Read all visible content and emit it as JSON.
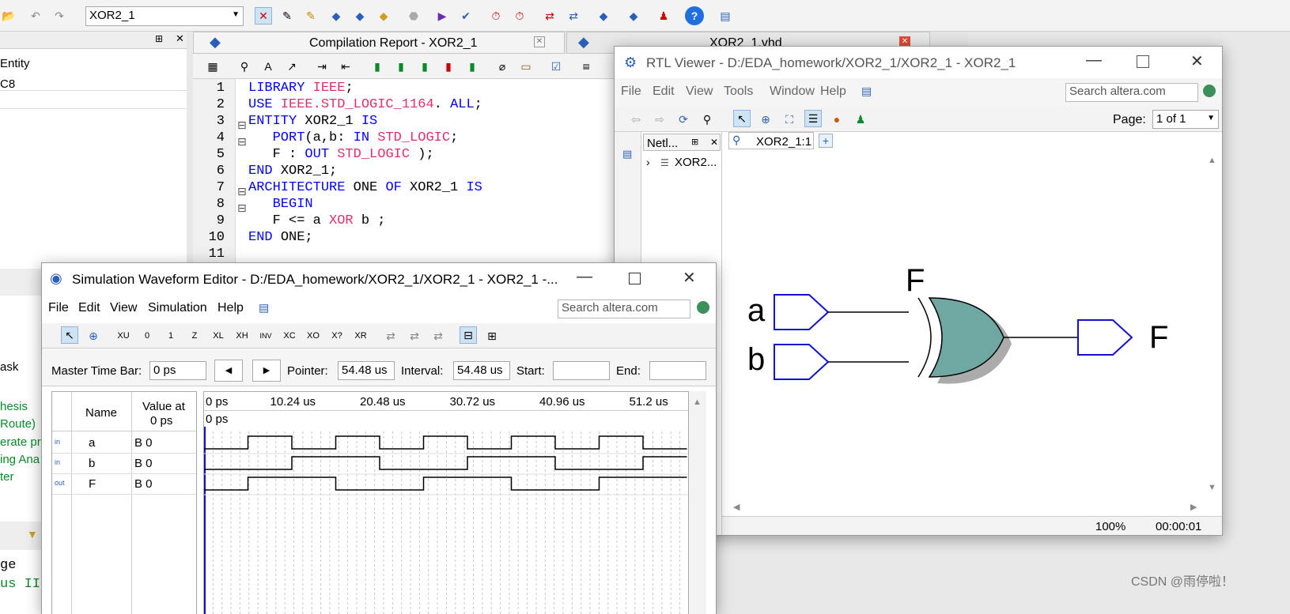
{
  "main": {
    "toolbar": {
      "entity_combo": "XOR2_1"
    },
    "left_panel": {
      "rows": [
        "Entity",
        "C8"
      ],
      "lower_rows": [
        "ask",
        "hesis",
        "Route)",
        "erate pr",
        "ing Ana",
        "ter",
        "ge",
        "us II"
      ]
    },
    "tabs": [
      {
        "label": "Compilation Report - XOR2_1"
      },
      {
        "label": "XOR2_1.vhd"
      }
    ],
    "code": [
      {
        "n": "1",
        "parts": [
          [
            "kw",
            "LIBRARY "
          ],
          [
            "ty",
            "IEEE"
          ],
          [
            "",
            "; "
          ]
        ]
      },
      {
        "n": "2",
        "parts": [
          [
            "kw",
            "USE "
          ],
          [
            "ty",
            "IEEE.STD_LOGIC_1164"
          ],
          [
            "",
            ". "
          ],
          [
            "kw",
            "ALL"
          ],
          [
            "",
            ";"
          ]
        ]
      },
      {
        "n": "3",
        "parts": [
          [
            "kw",
            "ENTITY "
          ],
          [
            "",
            "XOR2_1 "
          ],
          [
            "kw",
            "IS"
          ]
        ]
      },
      {
        "n": "4",
        "parts": [
          [
            "",
            "   "
          ],
          [
            "kw",
            "PORT"
          ],
          [
            "",
            "(a,b: "
          ],
          [
            "kw",
            "IN "
          ],
          [
            "ty",
            "STD_LOGIC"
          ],
          [
            "",
            ";"
          ]
        ]
      },
      {
        "n": "5",
        "parts": [
          [
            "",
            "   F : "
          ],
          [
            "kw",
            "OUT "
          ],
          [
            "ty",
            "STD_LOGIC"
          ],
          [
            "",
            " );"
          ]
        ]
      },
      {
        "n": "6",
        "parts": [
          [
            "kw",
            "END "
          ],
          [
            "",
            "XOR2_1;"
          ]
        ]
      },
      {
        "n": "7",
        "parts": [
          [
            "kw",
            "ARCHITECTURE "
          ],
          [
            "",
            "ONE "
          ],
          [
            "kw",
            "OF "
          ],
          [
            "",
            "XOR2_1 "
          ],
          [
            "kw",
            "IS"
          ]
        ]
      },
      {
        "n": "8",
        "parts": [
          [
            "",
            "   "
          ],
          [
            "kw",
            "BEGIN"
          ]
        ]
      },
      {
        "n": "9",
        "parts": [
          [
            "",
            "   F <= a "
          ],
          [
            "ty",
            "XOR "
          ],
          [
            "",
            "b ;"
          ]
        ]
      },
      {
        "n": "10",
        "parts": [
          [
            "kw",
            "END "
          ],
          [
            "",
            "ONE;"
          ]
        ]
      },
      {
        "n": "11",
        "parts": []
      }
    ]
  },
  "rtl": {
    "title": "RTL Viewer - D:/EDA_homework/XOR2_1/XOR2_1 - XOR2_1",
    "menu": [
      "File",
      "Edit",
      "View",
      "Tools",
      "Window",
      "Help"
    ],
    "search_placeholder": "Search altera.com",
    "page_label": "Page:",
    "page_value": "1 of 1",
    "netlist_tab": "Netl...",
    "tree_item": "XOR2...",
    "view_tab": "XOR2_1:1",
    "inputs": [
      "a",
      "b"
    ],
    "gate_label": "F",
    "output": "F",
    "zoom": "100%",
    "time": "00:00:01"
  },
  "sim": {
    "title": "Simulation Waveform Editor - D:/EDA_homework/XOR2_1/XOR2_1 - XOR2_1 -...",
    "menu": [
      "File",
      "Edit",
      "View",
      "Simulation",
      "Help"
    ],
    "search_placeholder": "Search altera.com",
    "master_time_label": "Master Time Bar:",
    "master_time_value": "0 ps",
    "pointer_label": "Pointer:",
    "pointer_value": "54.48 us",
    "interval_label": "Interval:",
    "interval_value": "54.48 us",
    "start_label": "Start:",
    "end_label": "End:",
    "col_name": "Name",
    "col_value_1": "Value at",
    "col_value_2": "0 ps",
    "time_ticks": [
      "0 ps",
      "10.24 us",
      "20.48 us",
      "30.72 us",
      "40.96 us",
      "51.2 us"
    ],
    "cursor_label": "0 ps",
    "signals": [
      {
        "type": "in",
        "name": "a",
        "value": "B 0",
        "levels": [
          0,
          1,
          0,
          1,
          0,
          1,
          0,
          1,
          0,
          1,
          0
        ]
      },
      {
        "type": "in",
        "name": "b",
        "value": "B 0",
        "levels": [
          0,
          0,
          1,
          1,
          0,
          0,
          1,
          1,
          0,
          0,
          1
        ]
      },
      {
        "type": "out",
        "name": "F",
        "value": "B 0",
        "levels": [
          0,
          1,
          1,
          0,
          0,
          1,
          1,
          0,
          0,
          1,
          1
        ]
      }
    ]
  },
  "watermark": "CSDN @雨停啦！"
}
